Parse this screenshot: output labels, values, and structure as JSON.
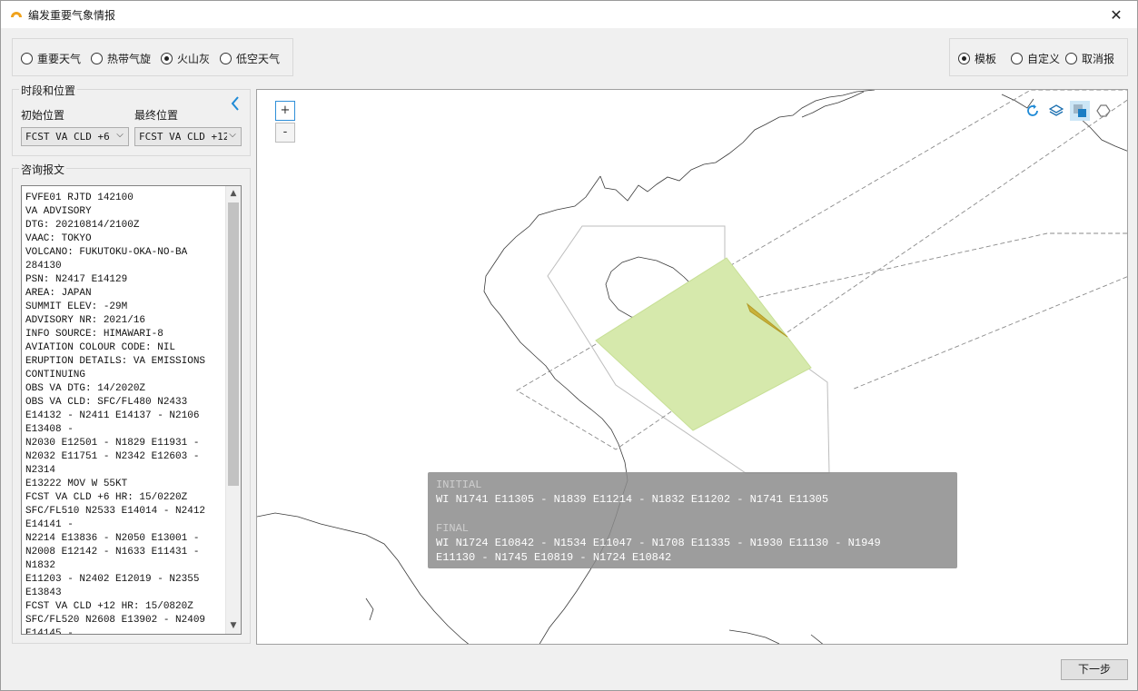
{
  "window": {
    "title": "编发重要气象情报"
  },
  "type_options": [
    {
      "label": "重要天气",
      "selected": false
    },
    {
      "label": "热带气旋",
      "selected": false
    },
    {
      "label": "火山灰",
      "selected": true
    },
    {
      "label": "低空天气",
      "selected": false
    }
  ],
  "mode_options": [
    {
      "label": "模板",
      "selected": true
    },
    {
      "label": "自定义",
      "selected": false
    },
    {
      "label": "取消报",
      "selected": false
    }
  ],
  "period_section": {
    "title": "时段和位置",
    "initial_label": "初始位置",
    "final_label": "最终位置",
    "initial_value": "FCST VA CLD +6",
    "final_value": "FCST VA CLD +12"
  },
  "advisory_section": {
    "title": "咨询报文",
    "text": "FVFE01 RJTD 142100\nVA ADVISORY\nDTG: 20210814/2100Z\nVAAC: TOKYO\nVOLCANO: FUKUTOKU-OKA-NO-BA\n284130\nPSN: N2417 E14129\nAREA: JAPAN\nSUMMIT ELEV: -29M\nADVISORY NR: 2021/16\nINFO SOURCE: HIMAWARI-8\nAVIATION COLOUR CODE: NIL\nERUPTION DETAILS: VA EMISSIONS\nCONTINUING\nOBS VA DTG: 14/2020Z\nOBS VA CLD: SFC/FL480 N2433\nE14132 - N2411 E14137 - N2106\nE13408 -\nN2030 E12501 - N1829 E11931 -\nN2032 E11751 - N2342 E12603 -\nN2314\nE13222 MOV W 55KT\nFCST VA CLD +6 HR: 15/0220Z\nSFC/FL510 N2533 E14014 - N2412\nE14141 -\nN2214 E13836 - N2050 E13001 -\nN2008 E12142 - N1633 E11431 -\nN1832\nE11203 - N2402 E12019 - N2355\nE13843\nFCST VA CLD +12 HR: 15/0820Z\nSFC/FL520 N2608 E13902 - N2409\nE14145 -"
  },
  "map": {
    "zoom_in_label": "+",
    "zoom_out_label": "-",
    "tools": [
      "refresh-icon",
      "layers-icon",
      "polygon-fill-icon",
      "hexagon-icon"
    ],
    "fill_color": "#d6e9ac",
    "overlap_color": "#c9b23a",
    "info": {
      "initial_header": "INITIAL",
      "initial_text": "WI N1741 E11305 - N1839 E11214 - N1832 E11202 - N1741 E11305",
      "final_header": "FINAL",
      "final_line1": "WI N1724 E10842 - N1534 E11047 - N1708 E11335 - N1930 E11130 - N1949",
      "final_line2": "E11130 - N1745 E10819 - N1724 E10842"
    }
  },
  "footer": {
    "next_label": "下一步"
  }
}
